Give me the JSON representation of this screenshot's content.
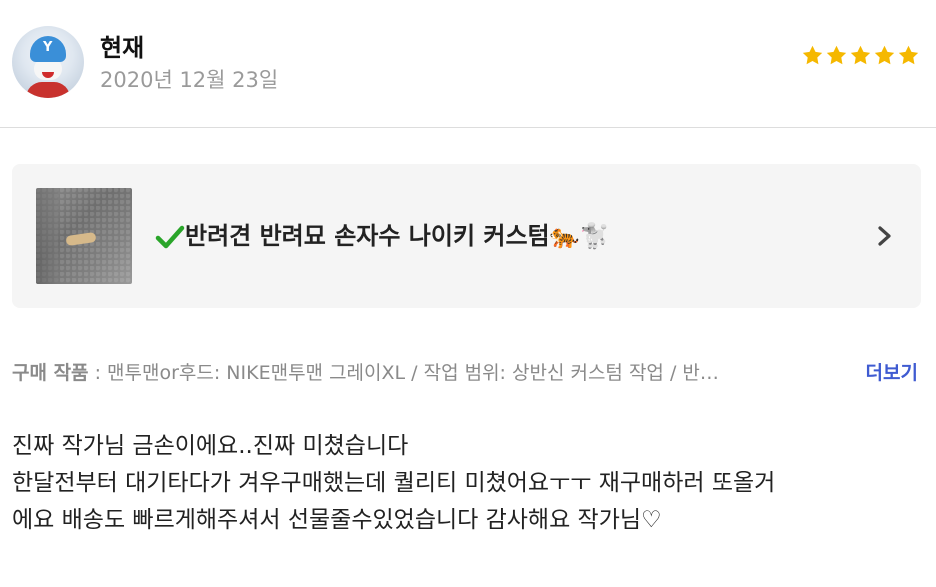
{
  "review": {
    "user_name": "현재",
    "date": "2020년 12월 23일",
    "rating": 5
  },
  "product": {
    "title": "반려견 반려묘 손자수 나이키 커스텀",
    "emoji": "🐅🐩"
  },
  "options": {
    "label": "구매 작품",
    "separator": " : ",
    "text": "맨투맨or후드: NIKE맨투맨 그레이XL / 작업 범위: 상반신 커스텀 작업 / 반…",
    "more_label": "더보기"
  },
  "body": {
    "lines": [
      "진짜 작가님 금손이에요..진짜 미쳤습니다",
      "한달전부터 대기타다가 겨우구매했는데 퀄리티 미쳤어요ㅜㅜ 재구매하러 또올거",
      "에요 배송도 빠르게해주셔서 선물줄수있었습니다 감사해요 작가님♡"
    ]
  },
  "colors": {
    "star": "#f5b800",
    "check": "#2aa52a",
    "link": "#3f5bd1"
  }
}
